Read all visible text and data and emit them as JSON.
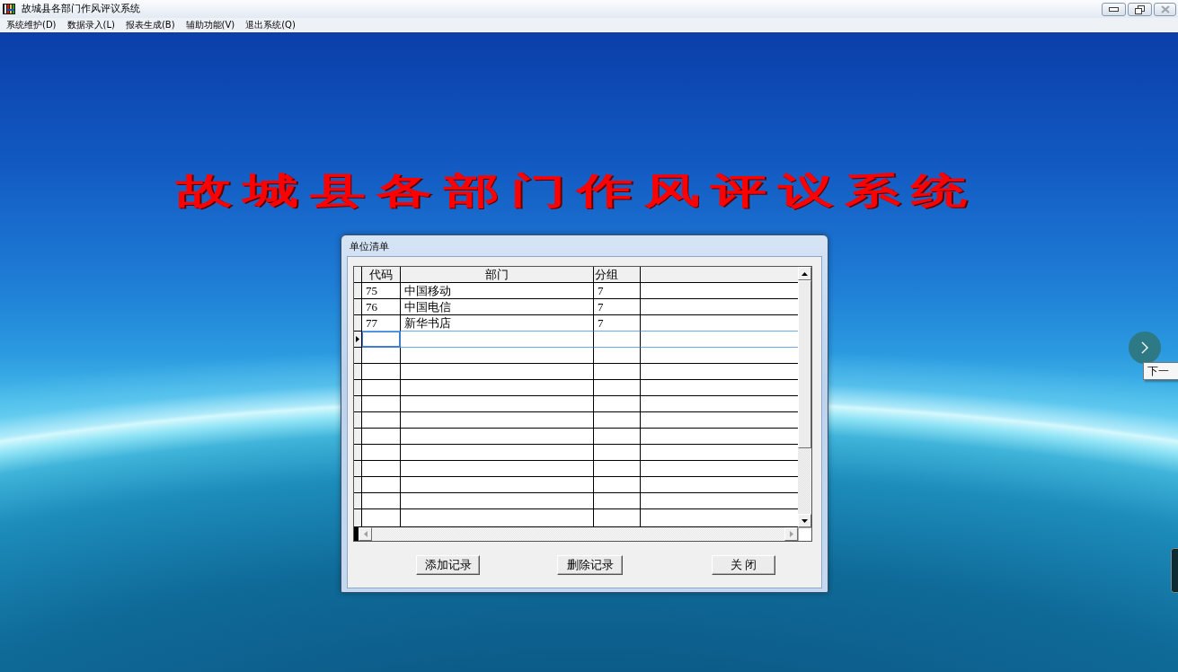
{
  "window": {
    "title": "故城县各部门作风评议系统"
  },
  "menu_bar": {
    "items": [
      "系统维护(D)",
      "数据录入(L)",
      "报表生成(B)",
      "辅助功能(V)",
      "退出系统(Q)"
    ]
  },
  "banner": {
    "title": "故城县各部门作风评议系统"
  },
  "dialog": {
    "title": "单位清单",
    "table": {
      "columns": [
        "代码",
        "部门",
        "分组"
      ],
      "rows": [
        {
          "cells": [
            "75",
            "中国移动",
            "7"
          ],
          "selected": false
        },
        {
          "cells": [
            "76",
            "中国电信",
            "7"
          ],
          "selected": false
        },
        {
          "cells": [
            "77",
            "新华书店",
            "7"
          ],
          "selected": false
        }
      ],
      "new_row": {
        "selected": true
      }
    },
    "buttons": [
      "添加记录",
      "删除记录",
      "关 闭"
    ]
  },
  "slideshow": {
    "tooltip": "下一"
  }
}
